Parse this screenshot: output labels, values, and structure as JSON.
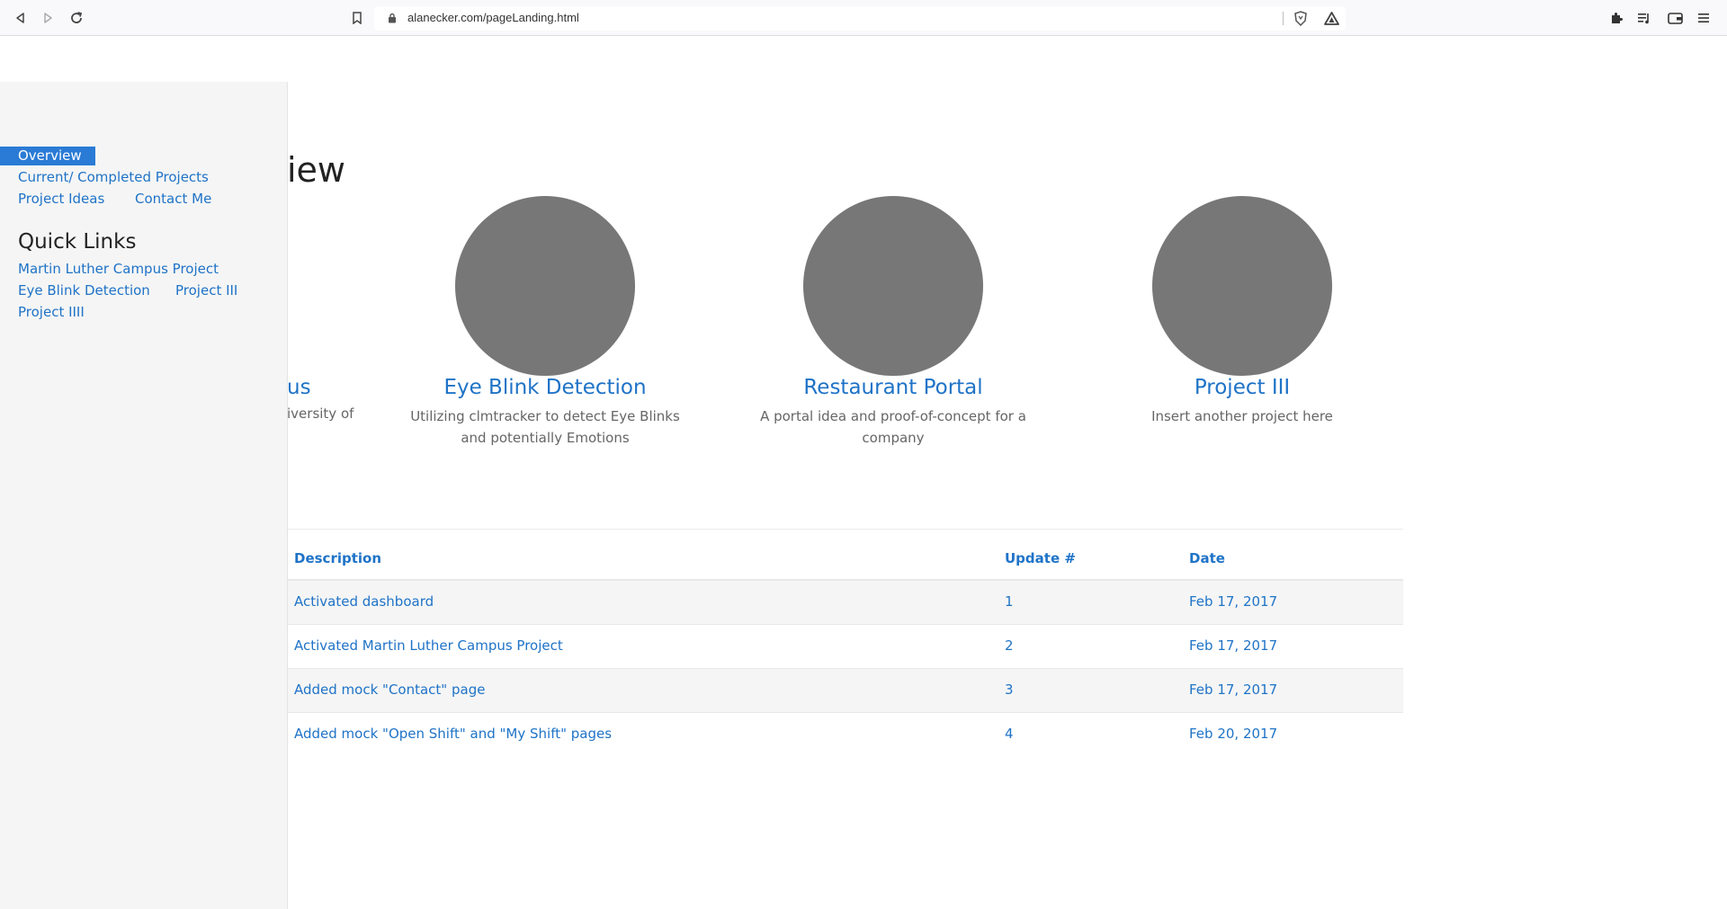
{
  "browser": {
    "url": "alanecker.com/pageLanding.html"
  },
  "sidebar": {
    "nav": {
      "overview": "Overview",
      "projects": "Current/ Completed Projects",
      "ideas": "Project Ideas",
      "contact": "Contact Me"
    },
    "quick_links_title": "Quick Links",
    "quick_links": {
      "martin": "Martin Luther Campus Project",
      "eye": "Eye Blink Detection",
      "p3": "Project III",
      "p4": "Project IIII"
    }
  },
  "main": {
    "heading_fragment": "iew",
    "partial_card": {
      "title_fragment": "us",
      "desc_fragment": "iversity of"
    },
    "cards": [
      {
        "title": "Eye Blink Detection",
        "desc": "Utilizing clmtracker to detect Eye Blinks and potentially Emotions"
      },
      {
        "title": "Restaurant Portal",
        "desc": "A portal idea and proof-of-concept for a company"
      },
      {
        "title": "Project III",
        "desc": "Insert another project here"
      }
    ]
  },
  "table": {
    "headers": {
      "description": "Description",
      "update": "Update #",
      "date": "Date"
    },
    "rows": [
      {
        "description": "Activated dashboard",
        "update": "1",
        "date": "Feb 17, 2017"
      },
      {
        "description": "Activated Martin Luther Campus Project",
        "update": "2",
        "date": "Feb 17, 2017"
      },
      {
        "description": "Added mock \"Contact\" page",
        "update": "3",
        "date": "Feb 17, 2017"
      },
      {
        "description": "Added mock \"Open Shift\" and \"My Shift\" pages",
        "update": "4",
        "date": "Feb 20, 2017"
      }
    ]
  },
  "colors": {
    "accent": "#1f73c7",
    "active_nav": "#2a7bd5",
    "placeholder": "#777777"
  }
}
